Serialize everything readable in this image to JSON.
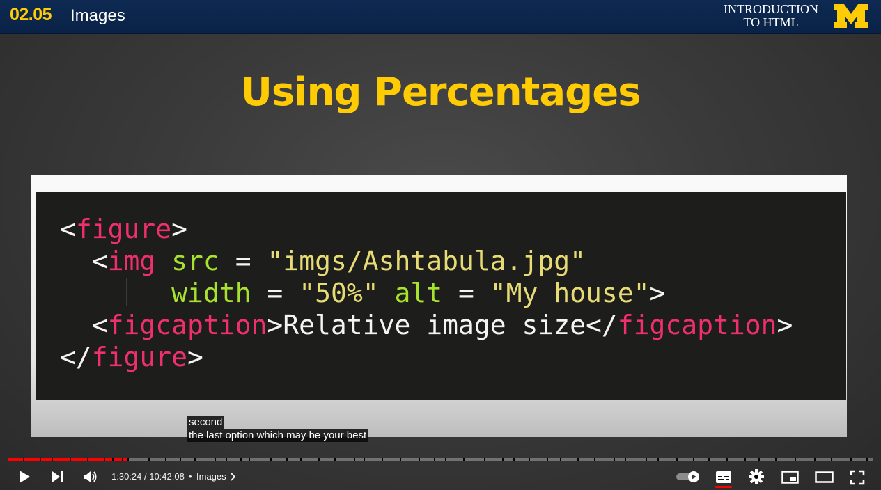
{
  "header": {
    "lesson_number": "02.05",
    "lesson_title": "Images",
    "course_title_line1": "INTRODUCTION",
    "course_title_line2": "TO HTML",
    "logo_letter": "M"
  },
  "slide": {
    "heading": "Using Percentages",
    "code": {
      "l1_open": "<",
      "l1_el": "figure",
      "l1_close": ">",
      "l2_open": "  <",
      "l2_el": "img",
      "l2_sp": " ",
      "l2_attr": "src",
      "l2_eq": " = ",
      "l2_str": "\"imgs/Ashtabula.jpg\"",
      "l3_indent": "       ",
      "l3_attr1": "width",
      "l3_eq1": " = ",
      "l3_str1": "\"50%\"",
      "l3_sp": " ",
      "l3_attr2": "alt",
      "l3_eq2": " = ",
      "l3_str2": "\"My house\"",
      "l3_close": ">",
      "l4_open": "  <",
      "l4_el1": "figcaption",
      "l4_mid": ">Relative image size</",
      "l4_el2": "figcaption",
      "l4_close": ">",
      "l5_open": "</",
      "l5_el": "figure",
      "l5_close": ">"
    }
  },
  "captions": {
    "line1": "second",
    "line2": "the last option which may be your best"
  },
  "player": {
    "played_fraction": 0.1403,
    "current_time": "1:30:24",
    "time_separator": " / ",
    "duration": "10:42:08",
    "chapter_separator": "•",
    "chapter": "Images",
    "icons": [
      "play-icon",
      "next-icon",
      "volume-icon",
      "chevron-right-icon",
      "autoplay-toggle-icon",
      "subtitles-icon",
      "settings-icon",
      "miniplayer-icon",
      "theater-mode-icon",
      "fullscreen-icon"
    ],
    "accent_color": "#ff0000",
    "subtitles_active": true
  }
}
